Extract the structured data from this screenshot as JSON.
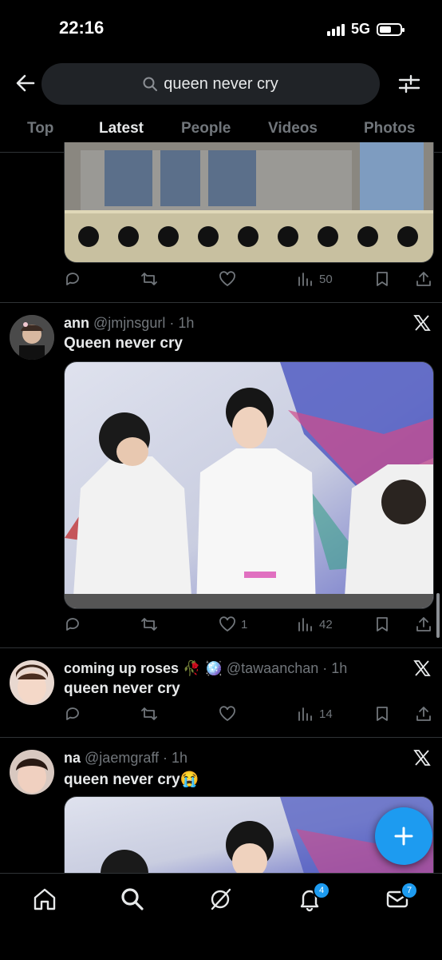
{
  "status_bar": {
    "time": "22:16",
    "network": "5G"
  },
  "search": {
    "query": "queen never cry"
  },
  "tabs": [
    {
      "label": "Top"
    },
    {
      "label": "Latest"
    },
    {
      "label": "People"
    },
    {
      "label": "Videos"
    },
    {
      "label": "Photos"
    }
  ],
  "active_tab": "Latest",
  "posts": [
    {
      "views": "50"
    },
    {
      "name": "ann",
      "handle": "@jmjnsgurl",
      "time": "1h",
      "text": "Queen never cry",
      "likes": "1",
      "views": "42"
    },
    {
      "name": "coming up roses",
      "name_emoji": "🥀 🪩",
      "handle": "@tawaanchan",
      "time": "1h",
      "text": "queen never cry",
      "views": "14"
    },
    {
      "name": "na",
      "handle": "@jaemgraff",
      "time": "1h",
      "text": "queen never cry",
      "text_emoji": "😭"
    }
  ],
  "bottom_nav": {
    "notifications_badge": "4",
    "messages_badge": "7"
  },
  "colors": {
    "accent": "#1d9bf0",
    "background": "#000000",
    "muted": "#71767b"
  }
}
